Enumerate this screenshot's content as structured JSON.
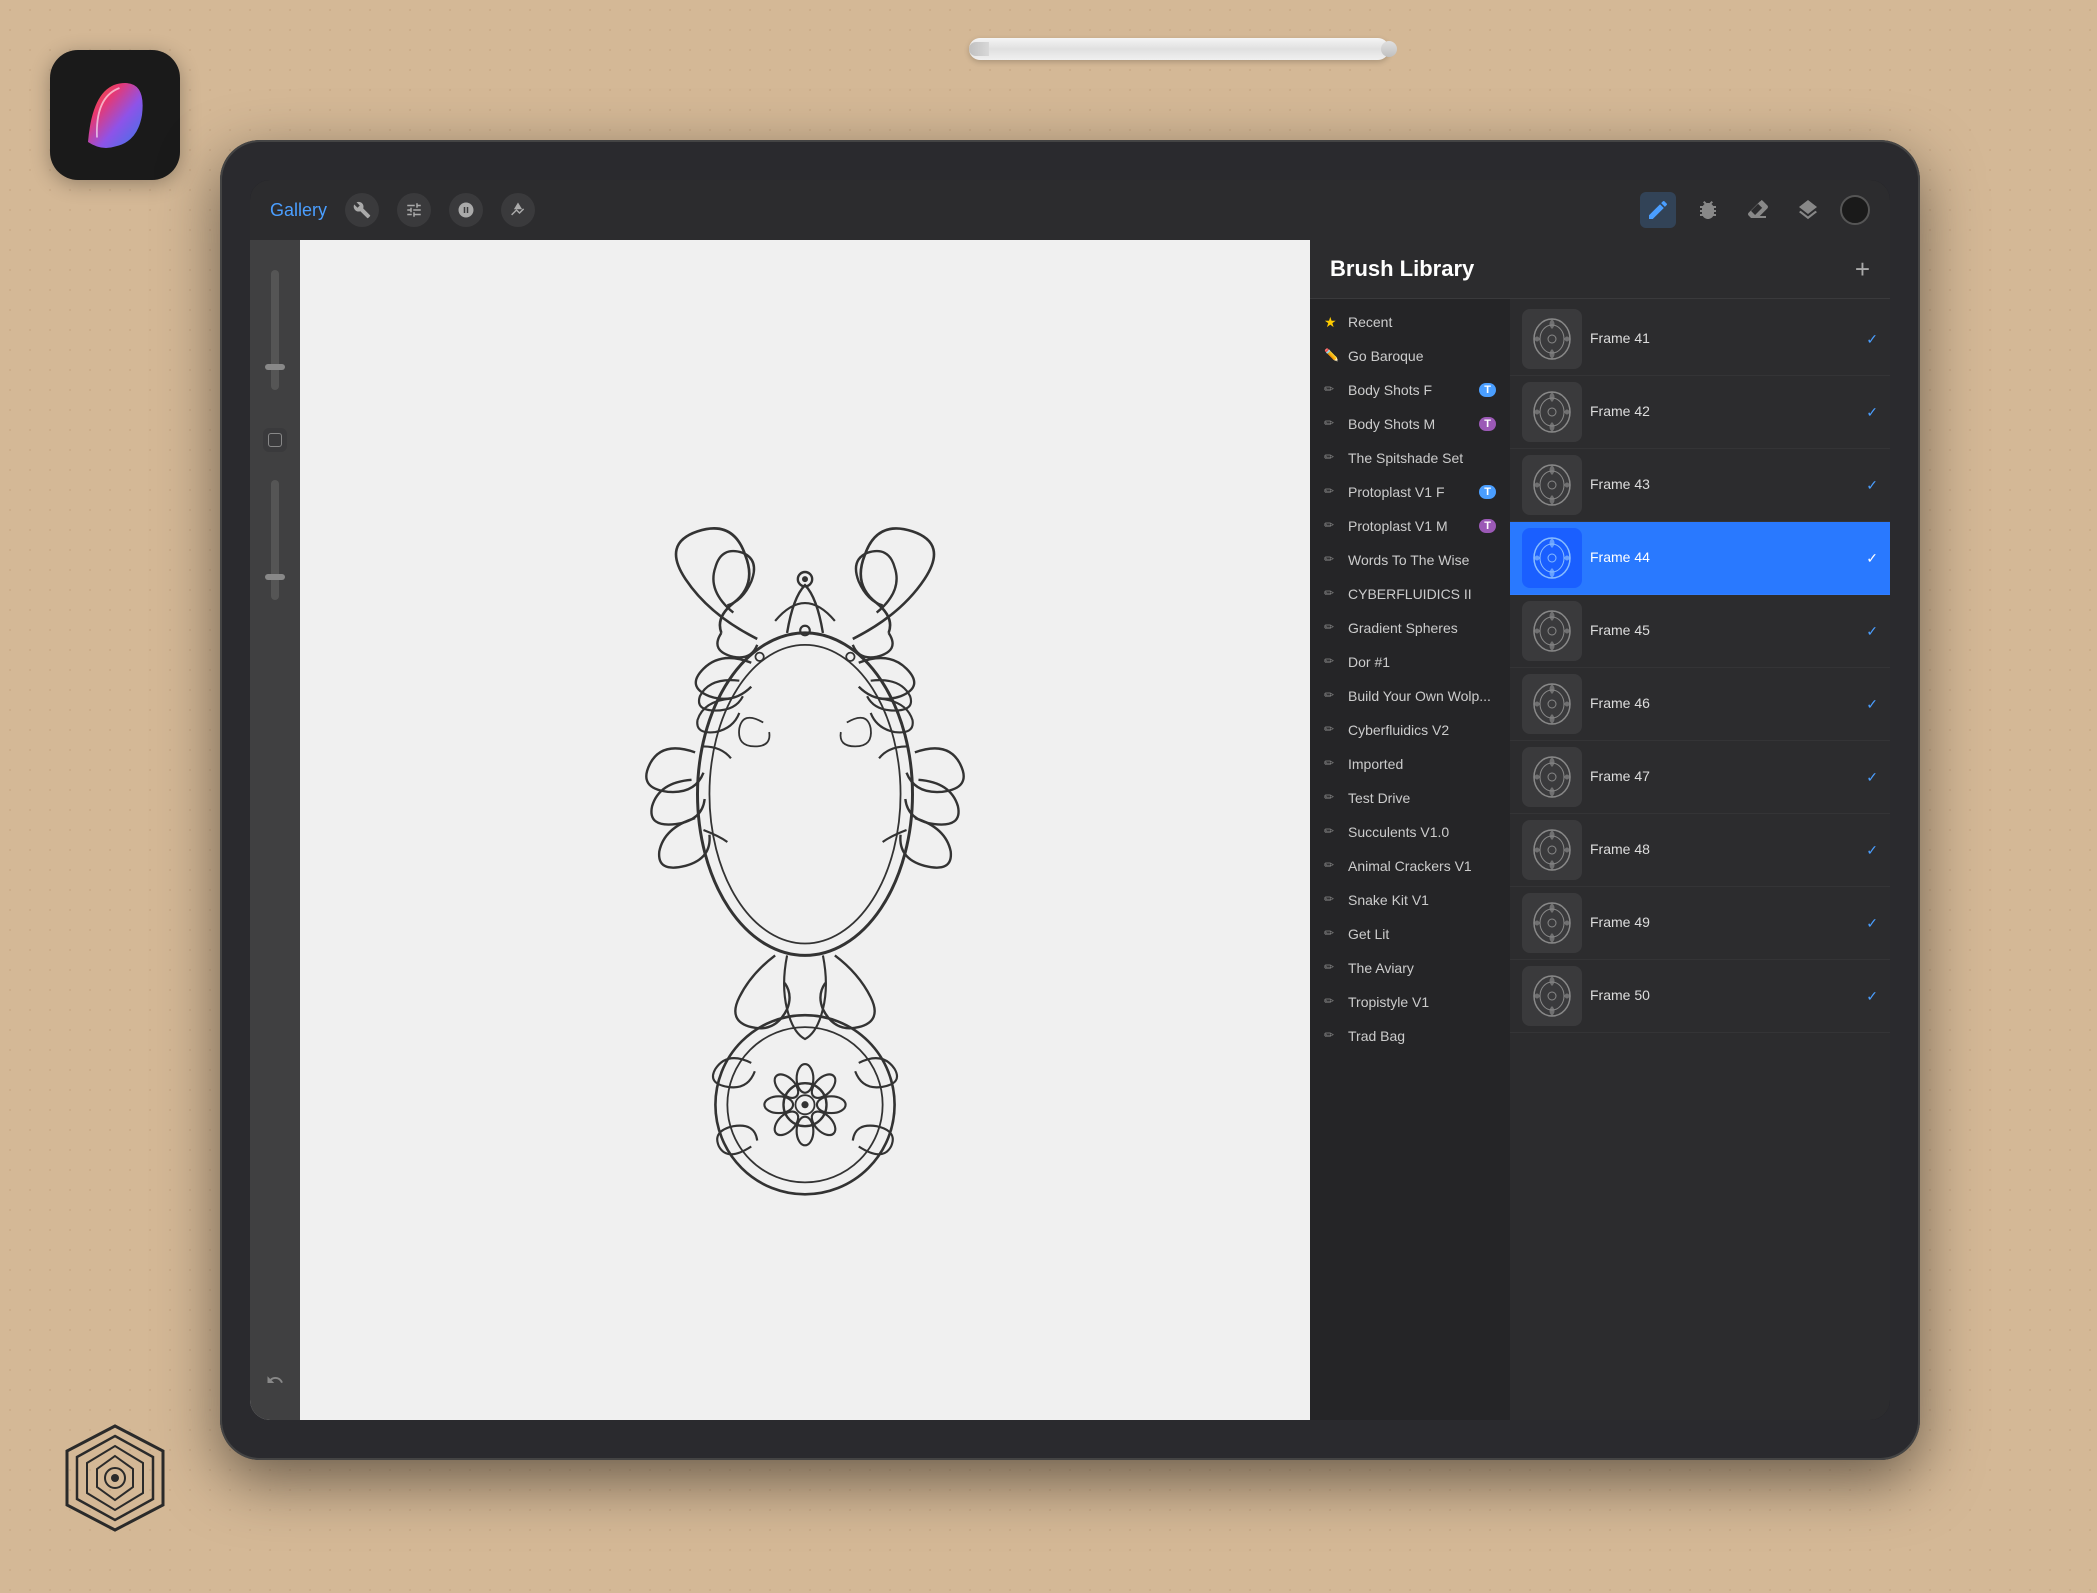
{
  "app": {
    "title": "Procreate"
  },
  "toolbar": {
    "gallery_label": "Gallery",
    "tools": [
      "wrench",
      "adjust",
      "smudge",
      "arrow"
    ],
    "right_tools": [
      "pen",
      "brush",
      "eraser",
      "layers"
    ],
    "color_label": "Color Picker"
  },
  "brush_library": {
    "title": "Brush Library",
    "add_button": "+",
    "categories": [
      {
        "id": "recent",
        "name": "Recent",
        "icon": "star",
        "active": false
      },
      {
        "id": "go-baroque",
        "name": "Go Baroque",
        "icon": "brush-blue",
        "active": false
      },
      {
        "id": "body-shots-f",
        "name": "Body Shots F",
        "icon": "brush-gray",
        "badge": "T",
        "badge_color": "blue",
        "active": false
      },
      {
        "id": "body-shots-m",
        "name": "Body Shots M",
        "icon": "brush-gray",
        "badge": "T",
        "badge_color": "purple",
        "active": false
      },
      {
        "id": "spitshade",
        "name": "The Spitshade Set",
        "icon": "brush-gray",
        "active": false
      },
      {
        "id": "protoplast-f",
        "name": "Protoplast V1 F",
        "icon": "brush-gray",
        "badge": "T",
        "badge_color": "blue",
        "active": false
      },
      {
        "id": "protoplast-m",
        "name": "Protoplast V1 M",
        "icon": "brush-gray",
        "badge": "T",
        "badge_color": "purple",
        "active": false
      },
      {
        "id": "words-to-wise",
        "name": "Words To The Wise",
        "icon": "brush-gray",
        "active": false
      },
      {
        "id": "cyberfluidics-ii",
        "name": "CYBERFLUIDICS II",
        "icon": "brush-gray",
        "active": false
      },
      {
        "id": "gradient-spheres",
        "name": "Gradient Spheres",
        "icon": "brush-gray",
        "active": false
      },
      {
        "id": "dor1",
        "name": "Dor #1",
        "icon": "brush-gray",
        "active": false
      },
      {
        "id": "build-your-own",
        "name": "Build Your Own Wolp...",
        "icon": "brush-gray",
        "active": false
      },
      {
        "id": "cyberfluidics-v2",
        "name": "Cyberfluidics V2",
        "icon": "brush-gray",
        "active": false
      },
      {
        "id": "imported",
        "name": "Imported",
        "icon": "brush-gray",
        "active": false
      },
      {
        "id": "test-drive",
        "name": "Test Drive",
        "icon": "brush-gray",
        "active": false
      },
      {
        "id": "succulents",
        "name": "Succulents V1.0",
        "icon": "brush-gray",
        "active": false
      },
      {
        "id": "animal-crackers",
        "name": "Animal Crackers V1",
        "icon": "brush-gray",
        "active": false
      },
      {
        "id": "snake-kit",
        "name": "Snake Kit V1",
        "icon": "brush-gray",
        "active": false
      },
      {
        "id": "get-lit",
        "name": "Get Lit",
        "icon": "brush-gray",
        "active": false
      },
      {
        "id": "aviary",
        "name": "The Aviary",
        "icon": "brush-gray",
        "active": false
      },
      {
        "id": "tropistyle",
        "name": "Tropistyle V1",
        "icon": "brush-gray",
        "active": false
      },
      {
        "id": "trad-bag",
        "name": "Trad Bag",
        "icon": "brush-gray",
        "active": false
      }
    ],
    "brushes": [
      {
        "id": "frame-41",
        "name": "Frame 41",
        "selected": false
      },
      {
        "id": "frame-42",
        "name": "Frame 42",
        "selected": false
      },
      {
        "id": "frame-43",
        "name": "Frame 43",
        "selected": false
      },
      {
        "id": "frame-44",
        "name": "Frame 44",
        "selected": true
      },
      {
        "id": "frame-45",
        "name": "Frame 45",
        "selected": false
      },
      {
        "id": "frame-46",
        "name": "Frame 46",
        "selected": false
      },
      {
        "id": "frame-47",
        "name": "Frame 47",
        "selected": false
      },
      {
        "id": "frame-48",
        "name": "Frame 48",
        "selected": false
      },
      {
        "id": "frame-49",
        "name": "Frame 49",
        "selected": false
      },
      {
        "id": "frame-50",
        "name": "Frame 50",
        "selected": false
      }
    ]
  },
  "colors": {
    "background": "#d4b896",
    "ipad_body": "#2a2a2e",
    "toolbar_bg": "#2c2c2e",
    "panel_bg": "#2c2c2e",
    "accent_blue": "#2979ff",
    "text_primary": "#ffffff",
    "text_secondary": "#cccccc"
  }
}
